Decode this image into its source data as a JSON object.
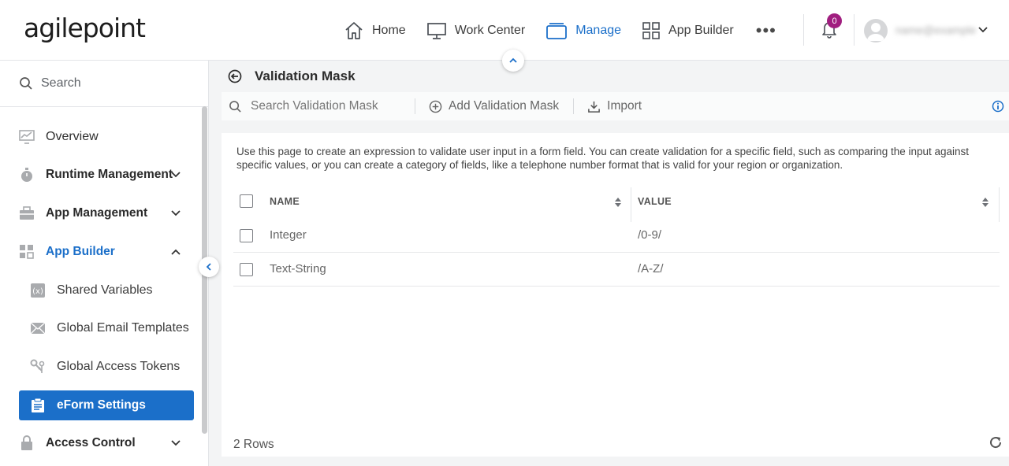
{
  "header": {
    "logo": "agilepoint",
    "nav": [
      {
        "label": "Home",
        "icon": "home-icon"
      },
      {
        "label": "Work Center",
        "icon": "monitor-icon"
      },
      {
        "label": "Manage",
        "icon": "briefcase-icon",
        "active": true
      },
      {
        "label": "App Builder",
        "icon": "grid-icon"
      }
    ],
    "more_label": "•••",
    "notification_count": "0",
    "username": "name@example"
  },
  "sidebar": {
    "search_label": "Search",
    "items": [
      {
        "label": "Overview",
        "icon": "chart-icon"
      },
      {
        "label": "Runtime Management",
        "icon": "stopwatch-icon"
      },
      {
        "label": "App Management",
        "icon": "toolbox-icon"
      },
      {
        "label": "App Builder",
        "icon": "app-builder-icon"
      },
      {
        "label": "Shared Variables",
        "icon": "variable-icon"
      },
      {
        "label": "Global Email Templates",
        "icon": "envelope-icon"
      },
      {
        "label": "Global Access Tokens",
        "icon": "keys-icon"
      },
      {
        "label": "eForm Settings",
        "icon": "clipboard-icon"
      },
      {
        "label": "Access Control",
        "icon": "lock-icon"
      }
    ]
  },
  "main": {
    "title": "Validation Mask",
    "toolbar": {
      "search_placeholder": "Search Validation Mask",
      "add_label": "Add Validation Mask",
      "import_label": "Import"
    },
    "description": "Use this page to create an expression to validate user input in a form field. You can create validation for a specific field, such as comparing the input against specific values, or you can create a category of fields, like a telephone number format that is valid for your region or organization.",
    "table": {
      "columns": [
        "NAME",
        "VALUE"
      ],
      "rows": [
        {
          "name": "Integer",
          "value": "/0-9/"
        },
        {
          "name": "Text-String",
          "value": "/A-Z/"
        }
      ]
    },
    "row_count": "2 Rows"
  },
  "colors": {
    "accent": "#1b6fc9",
    "badge": "#a01e7f"
  }
}
